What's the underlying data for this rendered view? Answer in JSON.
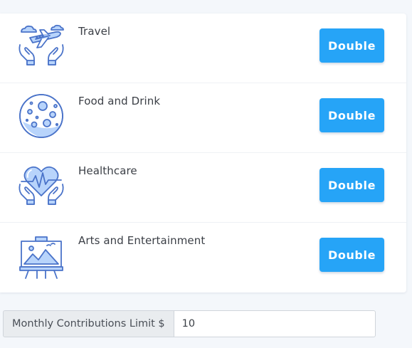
{
  "colors": {
    "accent": "#26a4f7",
    "icon_stroke": "#4a73c9",
    "icon_fill": "#b8d4fb"
  },
  "categories": [
    {
      "label": "Travel",
      "icon": "travel-icon",
      "button_label": "Double"
    },
    {
      "label": "Food and Drink",
      "icon": "food-and-drink-icon",
      "button_label": "Double"
    },
    {
      "label": "Healthcare",
      "icon": "healthcare-icon",
      "button_label": "Double"
    },
    {
      "label": "Arts and Entertainment",
      "icon": "arts-and-entertainment-icon",
      "button_label": "Double"
    }
  ],
  "contributions_limit": {
    "label": "Monthly Contributions Limit $",
    "value": "10"
  }
}
